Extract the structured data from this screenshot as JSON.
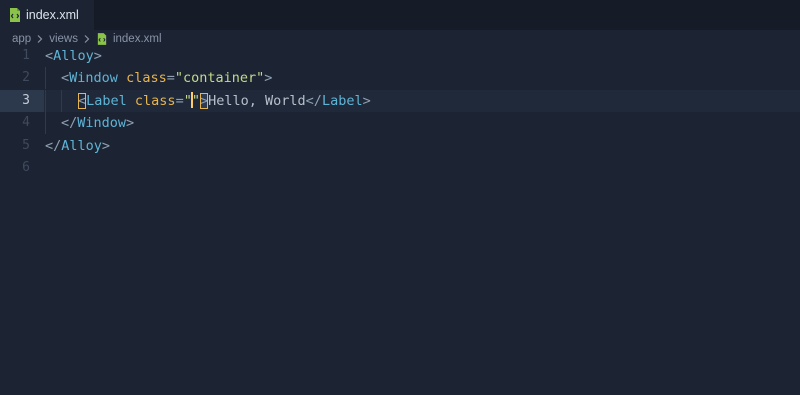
{
  "tabs": [
    {
      "label": "index.xml",
      "icon": "xml-file-icon",
      "active": true
    }
  ],
  "breadcrumb": [
    "app",
    "views",
    "index.xml"
  ],
  "colors": {
    "background": "#1c2433",
    "tag": "#5fb4d6",
    "attribute": "#e6b450",
    "string": "#c3d98b",
    "file_icon": "#8bc34a"
  },
  "editor": {
    "active_line": 3,
    "lines": [
      {
        "number": "1"
      },
      {
        "number": "2"
      },
      {
        "number": "3"
      },
      {
        "number": "4"
      },
      {
        "number": "5"
      },
      {
        "number": "6"
      }
    ],
    "tokens": {
      "alloy_open": "Alloy",
      "window_tag": "Window",
      "class_attr": "class",
      "container_value": "\"container\"",
      "label_tag": "Label",
      "empty_quote_open": "\"",
      "empty_quote_close": "\"",
      "hello_text": "Hello, World",
      "label_close": "Label",
      "window_close": "Window",
      "alloy_close": "Alloy"
    }
  }
}
